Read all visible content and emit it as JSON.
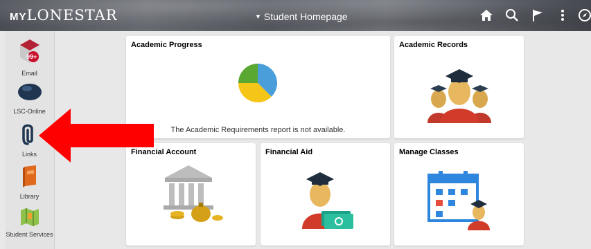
{
  "header": {
    "logo_my": "MY",
    "logo_name": "LONESTAR",
    "homepage_selector": "Student Homepage"
  },
  "sidebar": {
    "items": [
      {
        "label": "Email",
        "badge": "99+"
      },
      {
        "label": "LSC-Online"
      },
      {
        "label": "Links"
      },
      {
        "label": "Library"
      },
      {
        "label": "Student Services"
      }
    ]
  },
  "tiles": {
    "academic_progress": {
      "title": "Academic Progress",
      "message": "The Academic Requirements report is not available."
    },
    "academic_records": {
      "title": "Academic Records"
    },
    "financial_account": {
      "title": "Financial Account"
    },
    "financial_aid": {
      "title": "Financial Aid"
    },
    "manage_classes": {
      "title": "Manage Classes"
    }
  },
  "colors": {
    "annotation_arrow": "#ff0000",
    "pie_blue": "#4a9fdb",
    "pie_yellow": "#f5c518",
    "pie_green": "#5aa832",
    "badge_red": "#c8102e"
  }
}
